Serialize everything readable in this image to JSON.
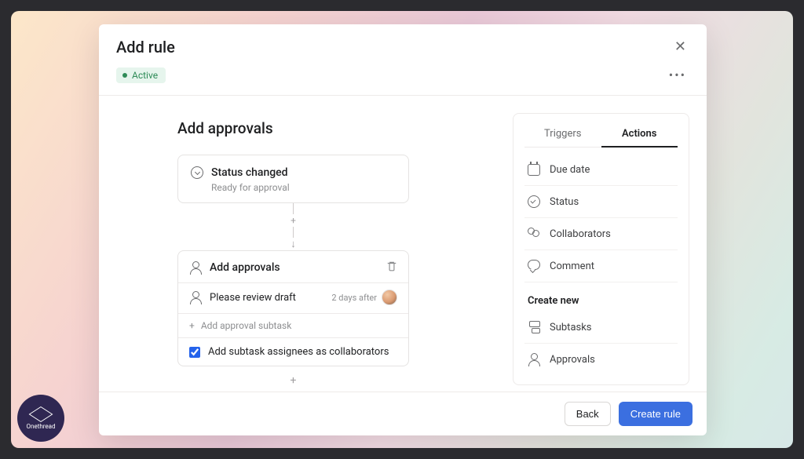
{
  "modal": {
    "title": "Add rule",
    "status": "Active"
  },
  "section": {
    "title": "Add approvals"
  },
  "trigger": {
    "title": "Status changed",
    "subtitle": "Ready for approval"
  },
  "action": {
    "title": "Add approvals",
    "review_label": "Please review draft",
    "due_text": "2 days after",
    "add_subtask_label": "Add approval subtask",
    "checkbox_label": "Add subtask assignees as collaborators",
    "checkbox_checked": true
  },
  "side": {
    "tabs": {
      "triggers": "Triggers",
      "actions": "Actions"
    },
    "items": {
      "due_date": "Due date",
      "status": "Status",
      "collaborators": "Collaborators",
      "comment": "Comment"
    },
    "create_new_title": "Create new",
    "create_items": {
      "subtasks": "Subtasks",
      "approvals": "Approvals"
    }
  },
  "footer": {
    "back": "Back",
    "create": "Create rule"
  },
  "brand": "Onethread"
}
